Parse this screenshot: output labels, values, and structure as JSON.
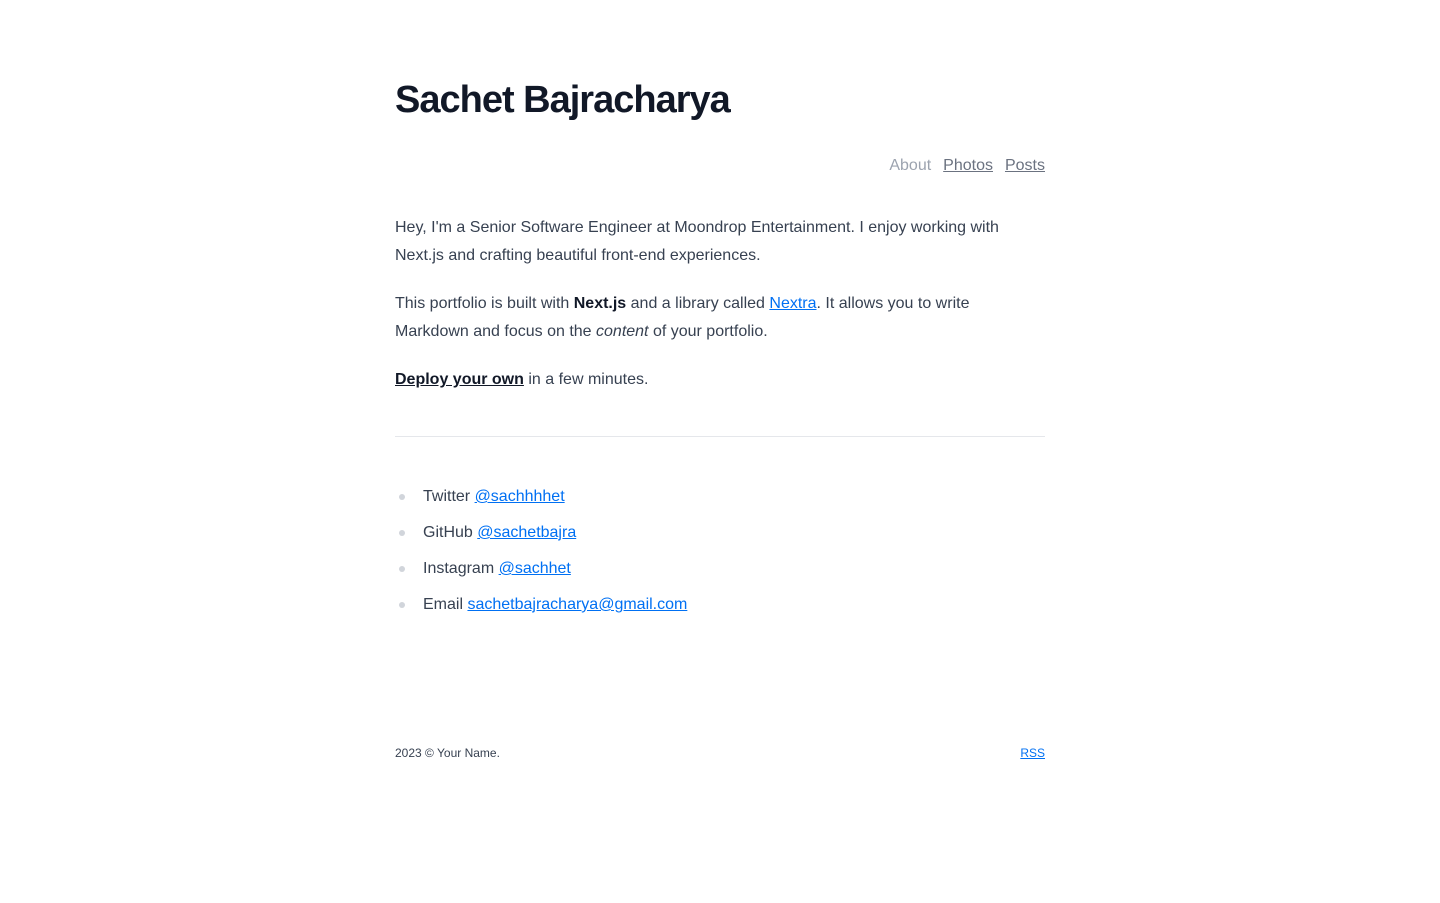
{
  "header": {
    "title": "Sachet Bajracharya"
  },
  "nav": {
    "items": [
      {
        "label": "About",
        "active": true
      },
      {
        "label": "Photos",
        "active": false
      },
      {
        "label": "Posts",
        "active": false
      }
    ]
  },
  "intro": {
    "p1": "Hey, I'm a Senior Software Engineer at Moondrop Entertainment. I enjoy working with Next.js and crafting beautiful front-end experiences.",
    "p2_before": "This portfolio is built with ",
    "p2_strong": "Next.js",
    "p2_middle": " and a library called ",
    "p2_link": "Nextra",
    "p2_after": ". It allows you to write Markdown and focus on the ",
    "p2_em": "content",
    "p2_end": " of your portfolio.",
    "p3_link": "Deploy your own",
    "p3_after": " in a few minutes."
  },
  "social": [
    {
      "label": "Twitter ",
      "handle": "@sachhhhet"
    },
    {
      "label": "GitHub ",
      "handle": "@sachetbajra"
    },
    {
      "label": "Instagram ",
      "handle": "@sachhet"
    },
    {
      "label": "Email ",
      "handle": "sachetbajracharya@gmail.com"
    }
  ],
  "footer": {
    "copyright": "2023 © Your Name.",
    "rss": "RSS"
  },
  "colors": {
    "title": "#111827",
    "text": "#374151",
    "link": "#0070f3",
    "muted": "#9ca3af"
  }
}
